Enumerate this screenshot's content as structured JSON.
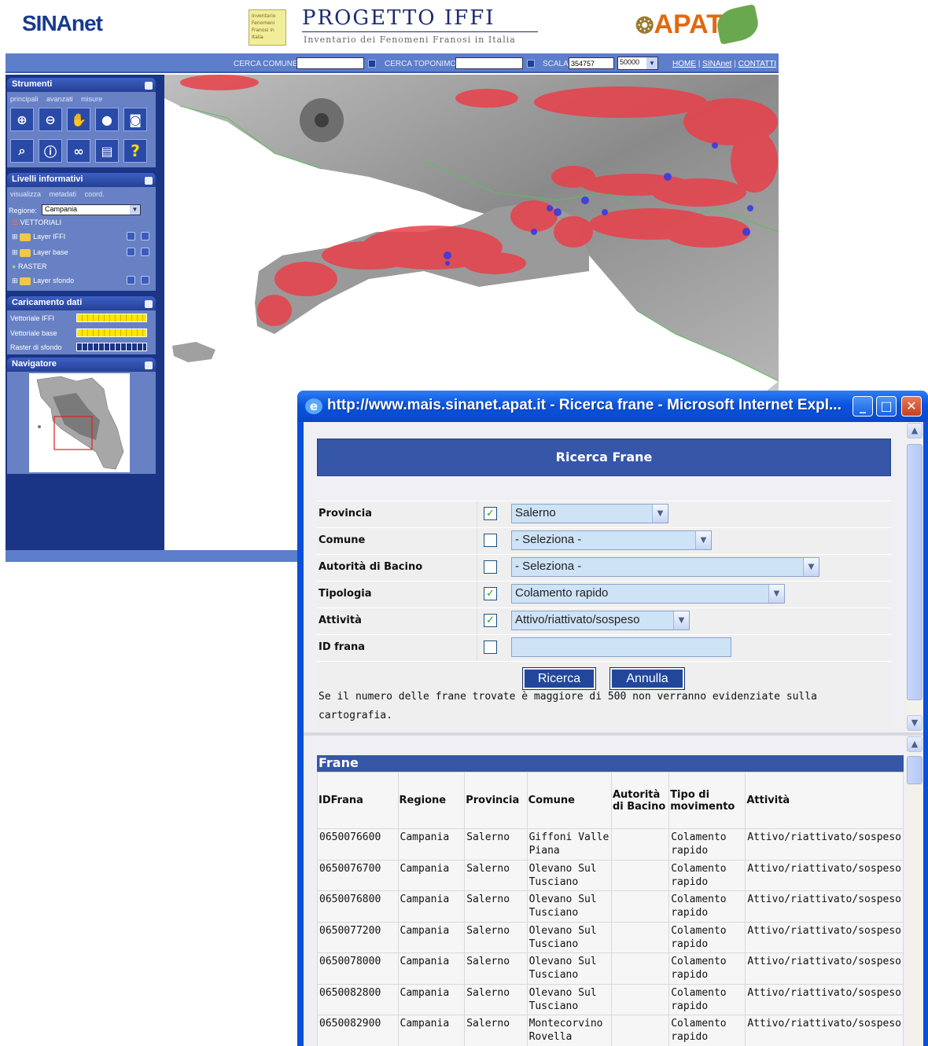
{
  "app": {
    "logo_left": "SINAnet",
    "iffi_box_text": "Inventario Fenomeni Franosi in Italia",
    "title": "PROGETTO IFFI",
    "subtitle": "Inventario dei Fenomeni Franosi in Italia",
    "logo_right": "APAT",
    "searchbar": {
      "cerca_comune_label": "CERCA COMUNE:",
      "cerca_comune_value": "",
      "cerca_toponimo_label": "CERCA TOPONIMO:",
      "cerca_toponimo_value": "",
      "scala_label": "SCALA:",
      "scala_value": "354757",
      "scala_select": "50000",
      "links": {
        "home": "HOME",
        "sinanet": "SINAnet",
        "contatti": "CONTATTI",
        "sep": "|"
      }
    },
    "sidebar": {
      "strumenti": {
        "title": "Strumenti",
        "tabs": [
          "principali",
          "avanzati",
          "misure"
        ]
      },
      "livelli": {
        "title": "Livelli informativi",
        "tabs": [
          "visualizza",
          "metadati",
          "coord."
        ],
        "regione_label": "Regione:",
        "regione_value": "Campania",
        "vettoriali": "VETTORIALI",
        "layer_iffi": "Layer IFFI",
        "layer_base": "Layer base",
        "raster": "RASTER",
        "layer_sfondo": "Layer sfondo"
      },
      "caricamento": {
        "title": "Caricamento dati",
        "rows": [
          {
            "label": "Vettoriale IFFI",
            "state": "full"
          },
          {
            "label": "Vettoriale base",
            "state": "full"
          },
          {
            "label": "Raster di sfondo",
            "state": "empty"
          }
        ]
      },
      "navigatore": {
        "title": "Navigatore"
      }
    }
  },
  "popup": {
    "window_title": "http://www.mais.sinanet.apat.it - Ricerca frane - Microsoft Internet Expl...",
    "buttons": {
      "minimize": "_",
      "maximize": "□",
      "close": "✕"
    },
    "form": {
      "heading": "Ricerca Frane",
      "rows": [
        {
          "label": "Provincia",
          "checked": true,
          "value": "Salerno"
        },
        {
          "label": "Comune",
          "checked": false,
          "value": "- Seleziona -"
        },
        {
          "label": "Autorità di Bacino",
          "checked": false,
          "value": "- Seleziona -"
        },
        {
          "label": "Tipologia",
          "checked": true,
          "value": "Colamento rapido"
        },
        {
          "label": "Attività",
          "checked": true,
          "value": "Attivo/riattivato/sospeso"
        },
        {
          "label": "ID frana",
          "checked": false,
          "value": ""
        }
      ],
      "ricerca_button": "Ricerca",
      "annulla_button": "Annulla",
      "note": "Se il numero delle frane trovate è maggiore di 500 non verranno evidenziate sulla cartografia."
    },
    "results": {
      "heading": "Frane",
      "columns": [
        "IDFrana",
        "Regione",
        "Provincia",
        "Comune",
        "Autorità di Bacino",
        "Tipo di movimento",
        "Attività"
      ],
      "rows": [
        [
          "0650076600",
          "Campania",
          "Salerno",
          "Giffoni Valle Piana",
          "",
          "Colamento rapido",
          "Attivo/riattivato/sospeso"
        ],
        [
          "0650076700",
          "Campania",
          "Salerno",
          "Olevano Sul Tusciano",
          "",
          "Colamento rapido",
          "Attivo/riattivato/sospeso"
        ],
        [
          "0650076800",
          "Campania",
          "Salerno",
          "Olevano Sul Tusciano",
          "",
          "Colamento rapido",
          "Attivo/riattivato/sospeso"
        ],
        [
          "0650077200",
          "Campania",
          "Salerno",
          "Olevano Sul Tusciano",
          "",
          "Colamento rapido",
          "Attivo/riattivato/sospeso"
        ],
        [
          "0650078000",
          "Campania",
          "Salerno",
          "Olevano Sul Tusciano",
          "",
          "Colamento rapido",
          "Attivo/riattivato/sospeso"
        ],
        [
          "0650082800",
          "Campania",
          "Salerno",
          "Olevano Sul Tusciano",
          "",
          "Colamento rapido",
          "Attivo/riattivato/sospeso"
        ],
        [
          "0650082900",
          "Campania",
          "Salerno",
          "Montecorvino Rovella",
          "",
          "Colamento rapido",
          "Attivo/riattivato/sospeso"
        ]
      ]
    }
  },
  "colors": {
    "sidebar": "#1a3585",
    "bluebar": "#5d7ecb",
    "landslide_red": "#e8404a",
    "landslide_blue": "#3a3ae0",
    "banner": "#3656a8"
  }
}
